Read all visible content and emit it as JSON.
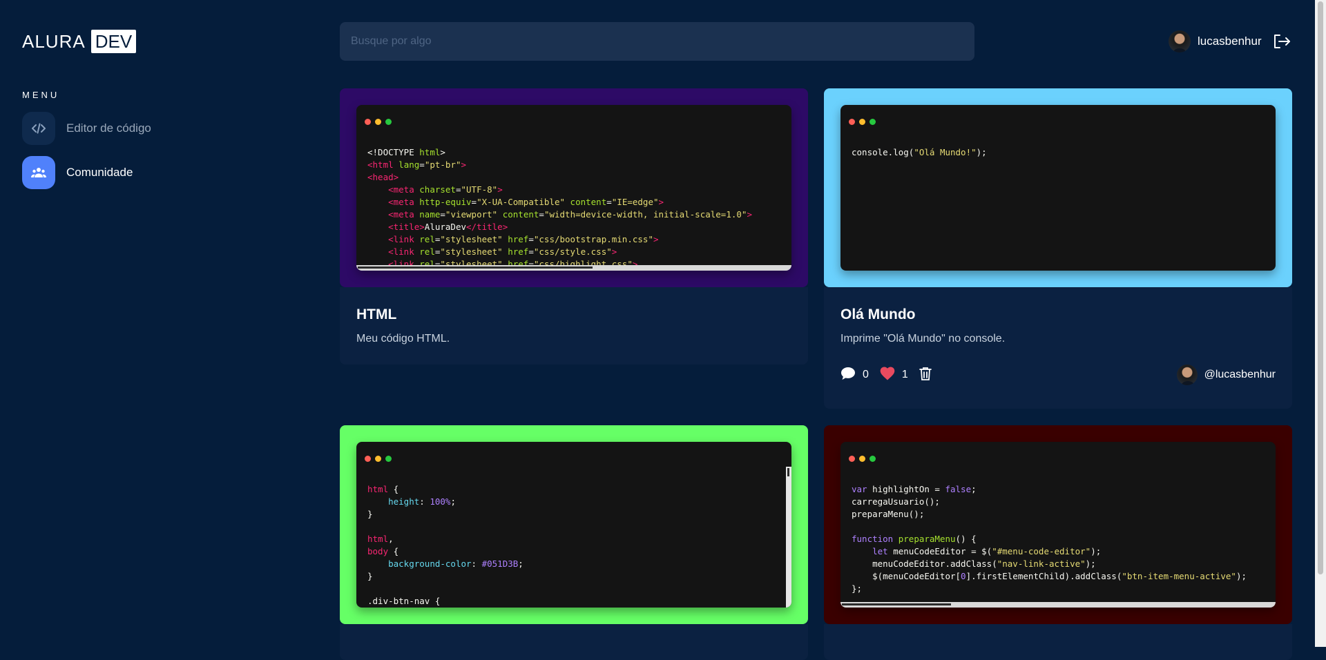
{
  "brand": {
    "part1": "ALURA",
    "part2": "DEV"
  },
  "sidebar": {
    "title": "MENU",
    "items": [
      {
        "label": "Editor de código",
        "icon": "code-icon",
        "active": false
      },
      {
        "label": "Comunidade",
        "icon": "users-icon",
        "active": true
      }
    ]
  },
  "search": {
    "placeholder": "Busque por algo",
    "value": ""
  },
  "user": {
    "name": "lucasbenhur",
    "avatar": "avatar",
    "logout_icon": "logout-icon"
  },
  "cards": [
    {
      "title": "HTML",
      "description": "Meu código HTML.",
      "frame_color": "#2d0a66",
      "code": "<!DOCTYPE html>\n<html lang=\"pt-br\">\n<head>\n    <meta charset=\"UTF-8\">\n    <meta http-equiv=\"X-UA-Compatible\" content=\"IE=edge\">\n    <meta name=\"viewport\" content=\"width=device-width, initial-scale=1.0\">\n    <title>AluraDev</title>\n    <link rel=\"stylesheet\" href=\"css/bootstrap.min.css\">\n    <link rel=\"stylesheet\" href=\"css/style.css\">\n    <link rel=\"stylesheet\" href=\"css/highlight.css\">"
    },
    {
      "title": "Olá Mundo",
      "description": "Imprime \"Olá Mundo\" no console.",
      "frame_color": "#6bd1fd",
      "code": "console.log(\"Olá Mundo!\");",
      "comments": "0",
      "likes": "1",
      "author": "@lucasbenhur"
    },
    {
      "title": "",
      "description": "",
      "frame_color": "#66ff66",
      "code": "html {\n    height: 100%;\n}\n\nhtml,\nbody {\n    background-color: #051D3B;\n}\n\n.div-btn-nav {"
    },
    {
      "title": "",
      "description": "",
      "frame_color": "#3a0000",
      "code": "var highlightOn = false;\ncarregaUsuario();\npreparaMenu();\n\nfunction preparaMenu() {\n    let menuCodeEditor = $(\"#menu-code-editor\");\n    menuCodeEditor.addClass(\"nav-link-active\");\n    $(menuCodeEditor[0].firstElementChild).addClass(\"btn-item-menu-active\");\n};"
    }
  ],
  "colors": {
    "background": "#051d3b",
    "accent": "#5081fb",
    "card_body": "#0b2141",
    "heart": "#e84a5f"
  }
}
